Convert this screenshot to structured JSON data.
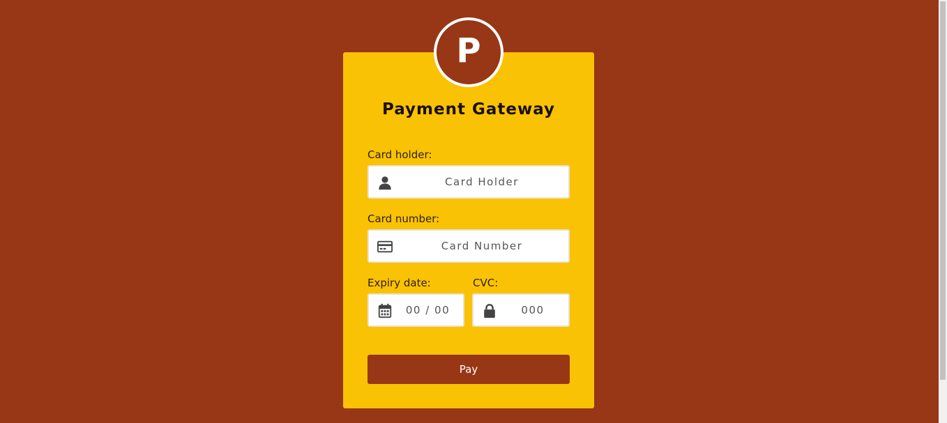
{
  "header": {
    "logo_letter": "P",
    "title": "Payment Gateway"
  },
  "form": {
    "card_holder": {
      "label": "Card holder:",
      "placeholder": "Card Holder",
      "icon": "user-icon"
    },
    "card_number": {
      "label": "Card number:",
      "placeholder": "Card Number",
      "icon": "credit-card-icon"
    },
    "expiry": {
      "label": "Expiry date:",
      "placeholder": "00 / 00",
      "icon": "calendar-icon"
    },
    "cvc": {
      "label": "CVC:",
      "placeholder": "000",
      "icon": "lock-icon"
    },
    "pay_label": "Pay"
  },
  "colors": {
    "background": "#973716",
    "card": "#fac205",
    "accent": "#973716",
    "icon": "#444444"
  }
}
